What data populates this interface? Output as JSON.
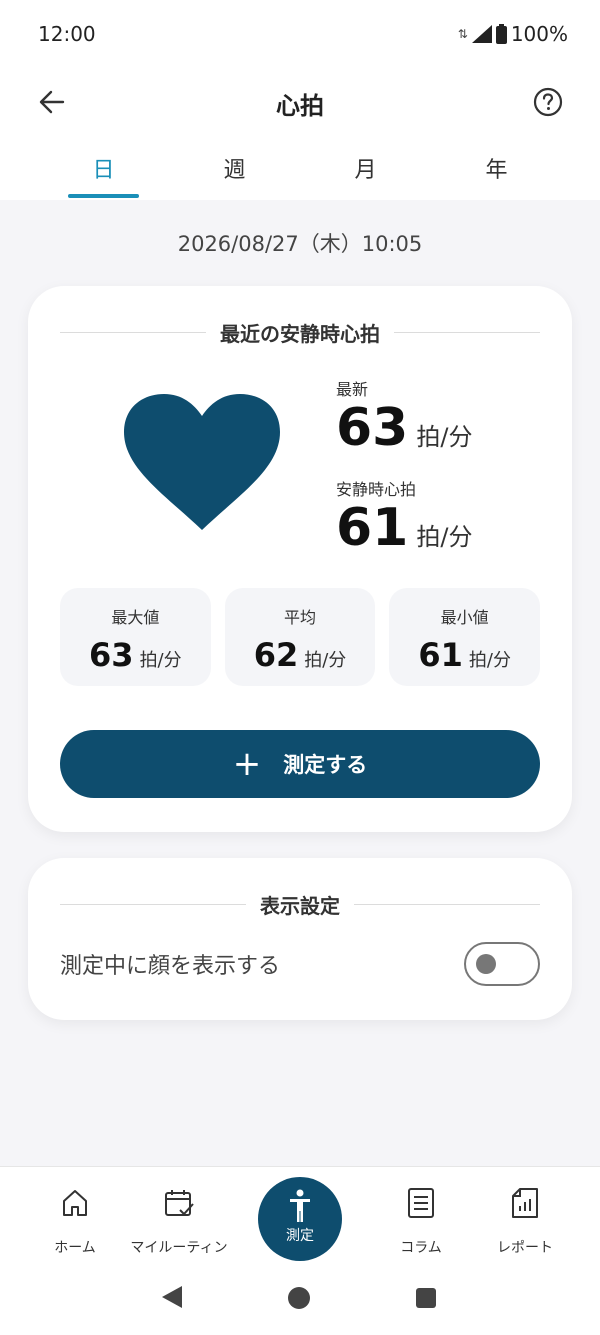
{
  "status_bar": {
    "time": "12:00",
    "battery": "100%"
  },
  "app_bar": {
    "title": "心拍"
  },
  "tabs": [
    {
      "label": "日",
      "active": true
    },
    {
      "label": "週",
      "active": false
    },
    {
      "label": "月",
      "active": false
    },
    {
      "label": "年",
      "active": false
    }
  ],
  "date": "2026/08/27（木）10:05",
  "resting_card": {
    "section_title": "最近の安静時心拍",
    "latest": {
      "label": "最新",
      "value": "63",
      "unit": "拍/分"
    },
    "resting": {
      "label": "安静時心拍",
      "value": "61",
      "unit": "拍/分"
    },
    "stats": [
      {
        "label": "最大値",
        "value": "63",
        "unit": "拍/分"
      },
      {
        "label": "平均",
        "value": "62",
        "unit": "拍/分"
      },
      {
        "label": "最小値",
        "value": "61",
        "unit": "拍/分"
      }
    ],
    "measure_button": {
      "icon": "+",
      "label": "測定する"
    }
  },
  "settings_card": {
    "section_title": "表示設定",
    "option_label": "測定中に顔を表示する",
    "option_enabled": false
  },
  "bottom_nav": {
    "home": "ホーム",
    "routine": "マイルーティン",
    "measure": "測定",
    "column": "コラム",
    "report": "レポート"
  },
  "colors": {
    "accent": "#1a8fb8",
    "primary": "#0e4d6e",
    "heart": "#0e4d6e"
  },
  "icons": [
    "back-arrow-icon",
    "help-icon",
    "heart-icon",
    "plus-icon",
    "home-icon",
    "calendar-check-icon",
    "person-icon",
    "list-icon",
    "report-icon"
  ]
}
